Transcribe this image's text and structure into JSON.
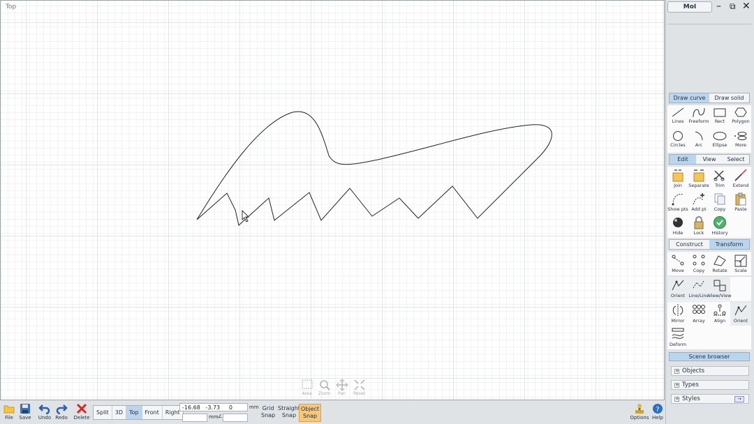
{
  "viewport": {
    "label": "Top",
    "nav": [
      "Area",
      "Zoom",
      "Pan",
      "Reset"
    ]
  },
  "bottom": {
    "file": "File",
    "save": "Save",
    "undo": "Undo",
    "redo": "Redo",
    "delete": "Delete",
    "views": [
      "Split",
      "3D",
      "Top",
      "Front",
      "Right"
    ],
    "active_view": "Top",
    "coords": {
      "x": "-16.68",
      "y": "-3.73",
      "z": "0",
      "unit": "mm",
      "dist_unit": "mm",
      "angle_symbol": "∠"
    },
    "grid_snap": [
      "Grid",
      "Snap"
    ],
    "straight_snap": [
      "Straight",
      "Snap"
    ],
    "object_snap": [
      "Object",
      "Snap"
    ],
    "options": "Options",
    "help": "Help"
  },
  "panel": {
    "app_title": "MoI",
    "draw_tabs": [
      "Draw curve",
      "Draw solid"
    ],
    "draw_buttons": [
      {
        "label": "Lines",
        "icon": "line-icon"
      },
      {
        "label": "Freeform",
        "icon": "freeform-icon"
      },
      {
        "label": "Rect",
        "icon": "rect-icon"
      },
      {
        "label": "Polygon",
        "icon": "polygon-icon"
      },
      {
        "label": "Circles",
        "icon": "circle-icon"
      },
      {
        "label": "Arc",
        "icon": "arc-icon"
      },
      {
        "label": "Ellipse",
        "icon": "ellipse-icon"
      },
      {
        "label": "More",
        "icon": "more-icon"
      }
    ],
    "edit_tabs": [
      "Edit",
      "View",
      "Select"
    ],
    "edit_buttons": [
      {
        "label": "Join",
        "icon": "join-icon"
      },
      {
        "label": "Separate",
        "icon": "separate-icon"
      },
      {
        "label": "Trim",
        "icon": "trim-icon"
      },
      {
        "label": "Extend",
        "icon": "extend-icon"
      },
      {
        "label": "Show pts",
        "icon": "show-points-icon"
      },
      {
        "label": "Add pt",
        "icon": "add-point-icon"
      },
      {
        "label": "Copy",
        "icon": "copy-icon"
      },
      {
        "label": "Paste",
        "icon": "paste-icon"
      },
      {
        "label": "Hide",
        "icon": "hide-icon"
      },
      {
        "label": "Lock",
        "icon": "lock-icon"
      },
      {
        "label": "History",
        "icon": "history-icon"
      }
    ],
    "transform_tabs": [
      "Construct",
      "Transform"
    ],
    "transform_buttons": [
      {
        "label": "Move",
        "icon": "move-icon"
      },
      {
        "label": "Copy",
        "icon": "copy-transform-icon"
      },
      {
        "label": "Rotate",
        "icon": "rotate-icon"
      },
      {
        "label": "Scale",
        "icon": "scale-icon"
      },
      {
        "label": "Orient",
        "icon": "orient-icon"
      },
      {
        "label": "Line/Line",
        "icon": "orient-line-icon"
      },
      {
        "label": "View/View",
        "icon": "orient-view-icon"
      },
      {
        "label": "",
        "icon": "blank"
      },
      {
        "label": "Mirror",
        "icon": "mirror-icon"
      },
      {
        "label": "Array",
        "icon": "array-icon"
      },
      {
        "label": "Align",
        "icon": "align-icon"
      },
      {
        "label": "Orient",
        "icon": "orient-icon-2"
      },
      {
        "label": "Deform",
        "icon": "deform-icon"
      }
    ],
    "scene_browser": {
      "title": "Scene browser",
      "sections": [
        "Objects",
        "Types",
        "Styles"
      ]
    }
  },
  "colors": {
    "tab_active": "#bcd5ee",
    "object_snap_active": "#f7c87a",
    "curve": "#222222"
  }
}
